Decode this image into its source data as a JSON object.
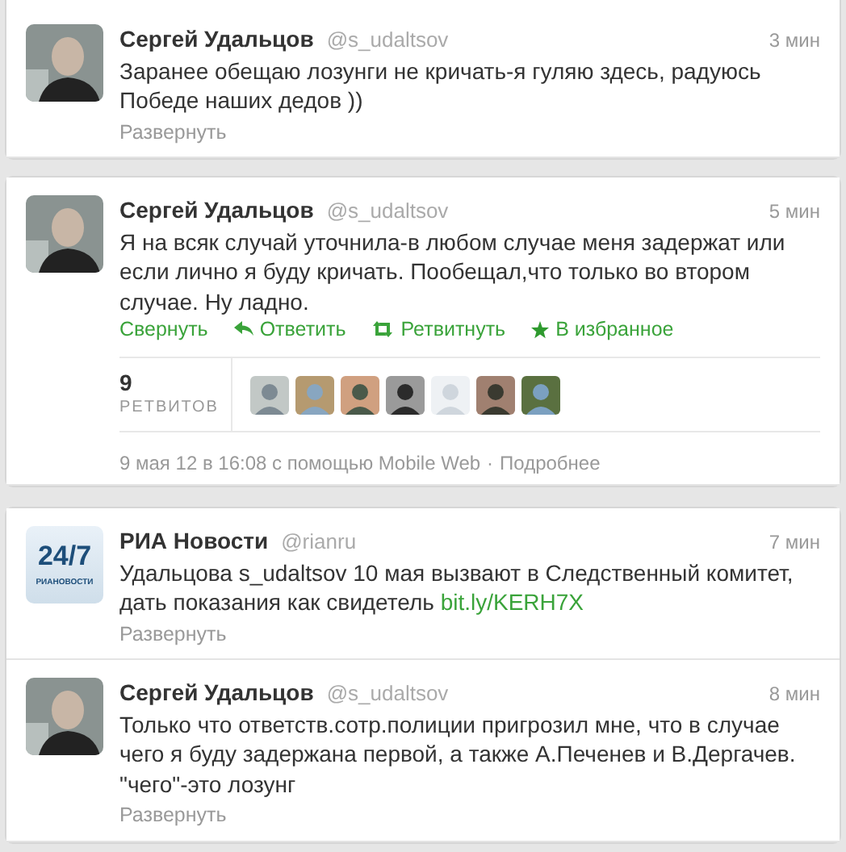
{
  "cards": [
    {
      "tweets": [
        {
          "name": "Сергей Удальцов",
          "handle": "@s_udaltsov",
          "time": "3 мин",
          "text": "Заранее обещаю лозунги не кричать-я гуляю здесь, радуюсь Победе наших дедов ))",
          "expanded": false,
          "expand_label": "Развернуть"
        }
      ]
    },
    {
      "tweets": [
        {
          "name": "Сергей Удальцов",
          "handle": "@s_udaltsov",
          "time": "5 мин",
          "text": "Я на всяк случай уточнила-в любом случае меня задержат или если лично я буду кричать. Пообещал,что только во втором случае. Ну ладно.",
          "expanded": true,
          "actions": [
            {
              "kind": "collapse",
              "label": "Свернуть"
            },
            {
              "kind": "reply",
              "label": "Ответить"
            },
            {
              "kind": "retweet",
              "label": "Ретвитнуть"
            },
            {
              "kind": "favorite",
              "label": "В избранное"
            }
          ],
          "retweets": {
            "count": "9",
            "label": "РЕТВИТОВ"
          },
          "footer_text": "9 мая 12 в 16:08 с помощью Mobile Web",
          "footer_sep": "·",
          "footer_link": "Подробнее"
        }
      ]
    },
    {
      "tweets": [
        {
          "logo_big": "24/7",
          "logo_small": "РИАНОВОСТИ",
          "name": "РИА Новости",
          "handle": "@rianru",
          "time": "7 мин",
          "text": "Удальцова s_udaltsov 10 мая вызвают в Следственный комитет, дать показания как свидетель",
          "link": "bit.ly/KERH7X",
          "expanded": false,
          "expand_label": "Развернуть"
        },
        {
          "name": "Сергей Удальцов",
          "handle": "@s_udaltsov",
          "time": "8 мин",
          "text": "Только что ответств.сотр.полиции пригрозил мне, что в случае чего я буду задержана первой, а также А.Печенев и В.Дергачев. \"чего\"-это лозунг",
          "expanded": false,
          "expand_label": "Развернуть"
        }
      ]
    }
  ]
}
